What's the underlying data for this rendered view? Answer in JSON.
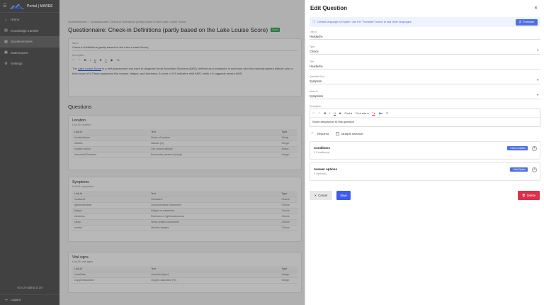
{
  "sidebar": {
    "brand_title": "Portal | MAREE",
    "items": [
      {
        "label": "Home",
        "icon": "home-icon",
        "glyph": "⌂"
      },
      {
        "label": "Knowledge transfer",
        "icon": "book-icon",
        "glyph": "▤"
      },
      {
        "label": "Questionnaires",
        "icon": "clipboard-icon",
        "glyph": "▦"
      },
      {
        "label": "Data Export",
        "icon": "export-icon",
        "glyph": "▣"
      },
      {
        "label": "Settings",
        "icon": "gear-icon",
        "glyph": "⚙"
      }
    ],
    "version": "v0.0.0-alpha.0.19",
    "logout": "Logout"
  },
  "main": {
    "breadcrumb": [
      "Questionnaires",
      "Questionnaire: Check-in Definitions (partly based on the Lake Louise Score)"
    ],
    "title": "Questionnaire: Check-in Definitions (partly based on the Lake Louise Score)",
    "badge": "Saved",
    "name_label": "Name",
    "name_value": "Check-in Definitions (partly based on the Lake Louise Score)",
    "desc_label": "Description",
    "desc_prefix": "The ",
    "desc_link": "Lake Louise Score",
    "desc_rest": " is a self-assessment tool used to diagnose Acute Mountain Sickness (AMS), defined as a headache in someone who has recently gained altitude, plus a total score of ≥ 3 from symptoms like nausea, fatigue, and dizziness. A score of 3-5 indicates mild AMS, while ≥ 6 suggests severe AMS.",
    "questions_heading": "Questions",
    "columns": [
      "Link-Id",
      "Text",
      "Type"
    ],
    "groups": [
      {
        "title": "Location",
        "sub": "Link-ID: location",
        "rows": [
          [
            "locationName",
            "Name of location",
            "String"
          ],
          [
            "altitude",
            "Altitude [m]",
            "Integer"
          ],
          [
            "location action",
            "Get current altitude",
            "Action"
          ],
          [
            "barometricPressure",
            "Barometric pressure [mbar]",
            "Integer"
          ]
        ]
      },
      {
        "title": "Symptoms",
        "sub": "Link-ID: symptoms",
        "rows": [
          [
            "headache",
            "Headache",
            "Choice"
          ],
          [
            "gastrointestinal",
            "Gastrointestinal Symptoms",
            "Choice"
          ],
          [
            "fatigue",
            "Fatigue or weakness",
            "Choice"
          ],
          [
            "dizziness",
            "Dizziness or lightheadedness",
            "Choice"
          ],
          [
            "sleep",
            "Sleep-related complaints",
            "Choice"
          ],
          [
            "mental",
            "Mental changes",
            "Choice"
          ]
        ]
      },
      {
        "title": "Vital signs",
        "sub": "Link-ID: vital signs",
        "rows": [
          [
            "heartRate",
            "Heartrate [bpm]",
            "Integer"
          ],
          [
            "oxygenSaturation",
            "Oxygen saturation [%]",
            "Integer"
          ]
        ]
      }
    ]
  },
  "drawer": {
    "title": "Edit Question",
    "info": "Default language is English. Use the \"Translate\" button to add other languages.",
    "translate": "Translate",
    "fields": [
      {
        "label": "Link-Id",
        "value": "Headache",
        "select": false
      },
      {
        "label": "Type",
        "value": "Choice",
        "select": true
      },
      {
        "label": "Title",
        "value": "Headache",
        "select": false
      },
      {
        "label": "Question Kind",
        "value": "Symptom",
        "select": true
      },
      {
        "label": "Move to",
        "value": "Symptoms",
        "select": true
      }
    ],
    "desc_label": "Description",
    "toolbar": {
      "font": "Font",
      "font_size": "Font size"
    },
    "desc_content": "Some description to this question",
    "required": "Required",
    "multiple": "Multiple selection",
    "conditions_title": "Conditions",
    "conditions_sub": "0 Condition(s)",
    "add_condition": "+ Add Condition",
    "answers_title": "Answer options",
    "answers_sub": "4 Option(s)",
    "add_option": "+ Add Option",
    "cancel": "Cancel",
    "save": "Save",
    "delete": "Delete",
    "accent": "#4f6fe6",
    "danger": "#d9324a"
  }
}
